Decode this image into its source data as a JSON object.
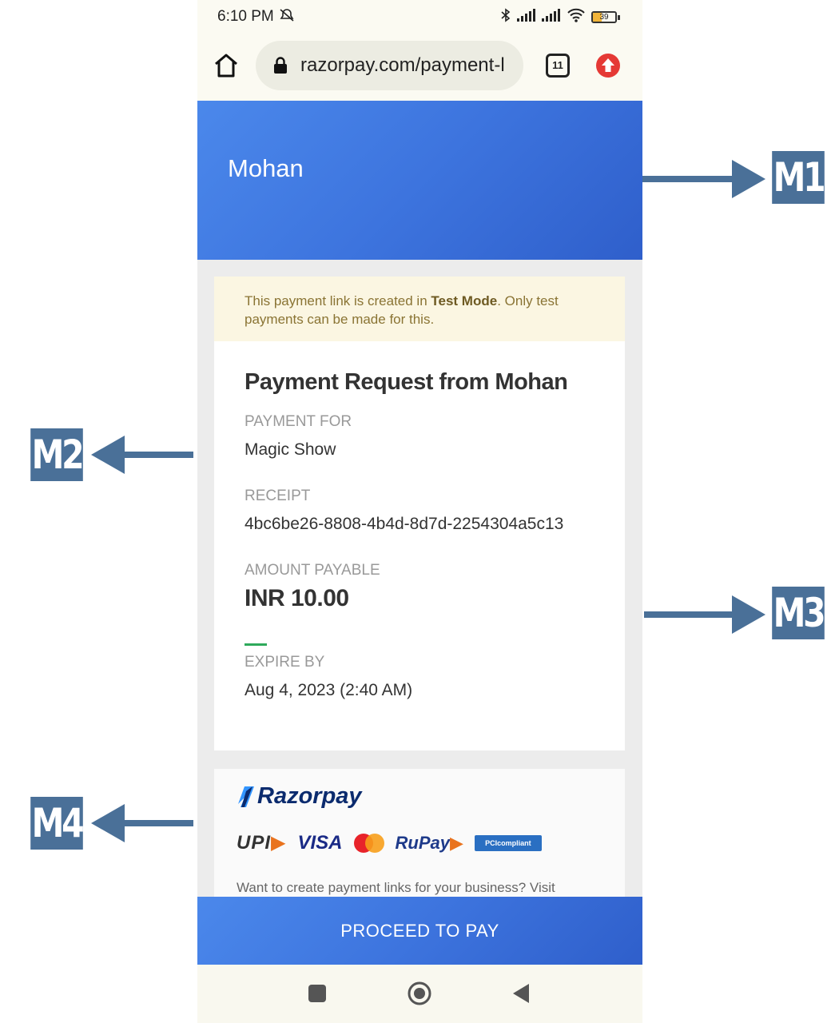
{
  "status_bar": {
    "time": "6:10 PM",
    "battery": "39",
    "battery_percent": 39
  },
  "browser": {
    "url": "razorpay.com/payment-l",
    "tab_count": "11"
  },
  "header": {
    "merchant_name": "Mohan"
  },
  "notice": {
    "prefix": "This payment link is created in ",
    "bold": "Test Mode",
    "suffix": ". Only test payments can be made for this."
  },
  "details": {
    "title": "Payment Request from Mohan",
    "payment_for_label": "PAYMENT FOR",
    "payment_for_value": "Magic Show",
    "receipt_label": "RECEIPT",
    "receipt_value": "4bc6be26-8808-4b4d-8d7d-2254304a5c13",
    "amount_label": "AMOUNT PAYABLE",
    "amount_value": "INR 10.00",
    "expire_label": "EXPIRE BY",
    "expire_value": "Aug 4, 2023 (2:40 AM)"
  },
  "brand": {
    "name": "Razorpay",
    "methods": {
      "upi": "UPI",
      "visa": "VISA",
      "rupay": "RuPay",
      "pci": "PCIcompliant"
    },
    "promo_text": "Want to create payment links for your business? Visit"
  },
  "actions": {
    "proceed_label": "PROCEED TO PAY"
  },
  "markers": {
    "m1": "M1",
    "m2": "M2",
    "m3": "M3",
    "m4": "M4"
  },
  "colors": {
    "primary_blue": "#3d74de",
    "marker_blue": "#4a7098",
    "notice_bg": "#fbf6e2",
    "accent_green": "#2eaa5b"
  }
}
